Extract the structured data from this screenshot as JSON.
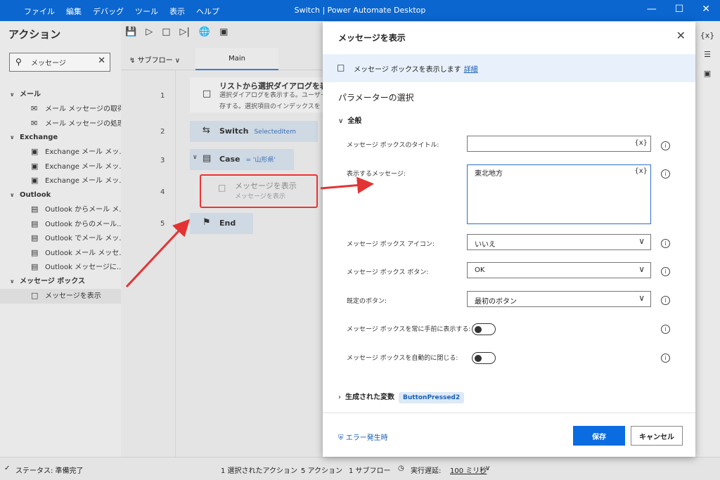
{
  "window": {
    "title": "Switch | Power Automate Desktop",
    "menu": [
      "ファイル",
      "編集",
      "デバッグ",
      "ツール",
      "表示",
      "ヘルプ"
    ]
  },
  "actions_panel": {
    "title": "アクション",
    "search_value": "メッセージ",
    "tree": [
      {
        "group": "メール",
        "items": [
          "メール メッセージの取得",
          "メール メッセージの処理"
        ]
      },
      {
        "group": "Exchange",
        "items": [
          "Exchange メール メッ...",
          "Exchange メール メッ...",
          "Exchange メール メッ..."
        ]
      },
      {
        "group": "Outlook",
        "items": [
          "Outlook からメール メ...",
          "Outlook からのメール...",
          "Outlook でメール メッ...",
          "Outlook メール メッセ...",
          "Outlook メッセージに..."
        ]
      },
      {
        "group": "メッセージ ボックス",
        "items": [
          "メッセージを表示"
        ]
      }
    ]
  },
  "designer": {
    "subflow_label": "サブフロー",
    "main_tab": "Main",
    "line_numbers": [
      "1",
      "2",
      "3",
      "4",
      "5"
    ],
    "step1_title": "リストから選択ダイアログを表示",
    "step1_desc_line1": "選択ダイアログを表示する。ユーザーの",
    "step1_desc_line2": "存する。選択項目のインデックスを",
    "switch_label": "Switch",
    "switch_tag": "SelectedItem",
    "case_label": "Case",
    "case_tag": "= '山形県'",
    "msg_step_title": "メッセージを表示",
    "msg_step_sub": "メッセージを表示",
    "end_label": "End"
  },
  "modal": {
    "title": "メッセージを表示",
    "info_text": "メッセージ ボックスを表示します",
    "info_link": "詳細",
    "params_title": "パラメーターの選択",
    "section_general": "全般",
    "labels": {
      "title": "メッセージ ボックスのタイトル:",
      "message": "表示するメッセージ:",
      "icon": "メッセージ ボックス アイコン:",
      "buttons": "メッセージ ボックス ボタン:",
      "default_button": "既定のボタン:",
      "top_most": "メッセージ ボックスを常に手前に表示する:",
      "auto_close": "メッセージ ボックスを自動的に閉じる:"
    },
    "values": {
      "title": "",
      "message": "東北地方",
      "icon": "いいえ",
      "buttons": "OK",
      "default_button": "最初のボタン"
    },
    "var_token": "{x}",
    "generated_vars_label": "生成された変数",
    "generated_var": "ButtonPressed2",
    "on_error": "エラー発生時",
    "save": "保存",
    "cancel": "キャンセル"
  },
  "status_bar": {
    "status": "ステータス: 準備完了",
    "selected": "1 選択されたアクション",
    "actions": "5 アクション",
    "subflows": "1 サブフロー",
    "delay_label": "実行遅延:",
    "delay_value": "100 ミリ秒"
  },
  "colors": {
    "titlebar": "#0b66d0",
    "accent": "#0b6be0",
    "annotation": "#e33333"
  }
}
